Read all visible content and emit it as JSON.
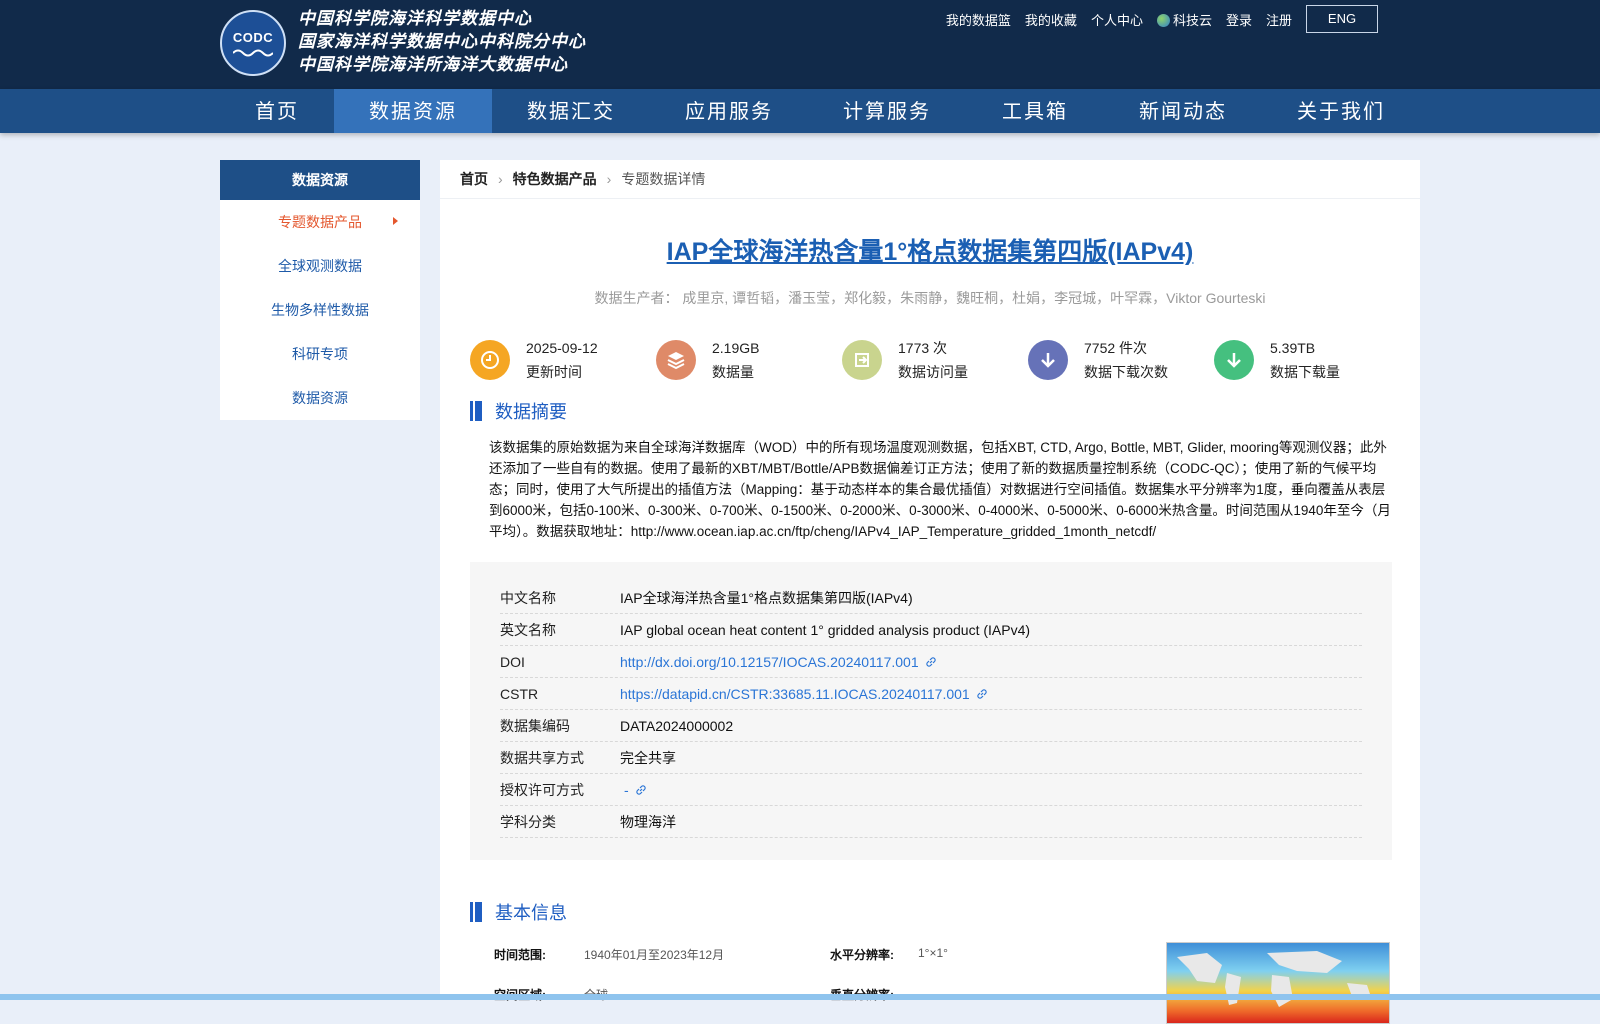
{
  "header": {
    "logo_abbr": "CODC",
    "org_lines": [
      "中国科学院海洋科学数据中心",
      "国家海洋科学数据中心中科院分中心",
      "中国科学院海洋所海洋大数据中心"
    ],
    "user_links": [
      "我的数据篮",
      "我的收藏",
      "个人中心",
      "科技云",
      "登录",
      "注册"
    ],
    "lang": "ENG",
    "colors": {
      "header_bg": "#112a4a",
      "nav_bg": "#1e4f87",
      "nav_active": "#3472ba"
    }
  },
  "nav": {
    "items": [
      "首页",
      "数据资源",
      "数据汇交",
      "应用服务",
      "计算服务",
      "工具箱",
      "新闻动态",
      "关于我们"
    ],
    "active": "数据资源"
  },
  "sidebar": {
    "title": "数据资源",
    "items": [
      "专题数据产品",
      "全球观测数据",
      "生物多样性数据",
      "科研专项",
      "数据资源"
    ],
    "active": "专题数据产品"
  },
  "breadcrumb": [
    "首页",
    "特色数据产品",
    "专题数据详情"
  ],
  "dataset": {
    "title": "IAP全球海洋热含量1°格点数据集第四版(IAPv4)",
    "producers_label": "数据生产者：",
    "producers": "成里京, 谭哲韬，潘玉莹，郑化毅，朱雨静，魏旺桐，杜娟，李冠城，叶罕霖，Viktor Gourteski"
  },
  "stats": [
    {
      "value": "2025-09-12",
      "label": "更新时间",
      "icon": "clock-icon",
      "color": "#f5a623"
    },
    {
      "value": "2.19GB",
      "label": "数据量",
      "icon": "layers-icon",
      "color": "#df8a68"
    },
    {
      "value": "1773 次",
      "label": "数据访问量",
      "icon": "access-icon",
      "color": "#c9d48e"
    },
    {
      "value": "7752 件次",
      "label": "数据下载次数",
      "icon": "download-count-icon",
      "color": "#6672b8"
    },
    {
      "value": "5.39TB",
      "label": "数据下载量",
      "icon": "download-volume-icon",
      "color": "#45c07f"
    }
  ],
  "abstract": {
    "title": "数据摘要",
    "text": "该数据集的原始数据为来自全球海洋数据库（WOD）中的所有现场温度观测数据，包括XBT, CTD, Argo, Bottle, MBT, Glider, mooring等观测仪器；此外还添加了一些自有的数据。使用了最新的XBT/MBT/Bottle/APB数据偏差订正方法；使用了新的数据质量控制系统（CODC-QC）；使用了新的气候平均态；同时，使用了大气所提出的插值方法（Mapping：基于动态样本的集合最优插值）对数据进行空间插值。数据集水平分辨率为1度，垂向覆盖从表层到6000米，包括0-100米、0-300米、0-700米、0-1500米、0-2000米、0-3000米、0-4000米、0-5000米、0-6000米热含量。时间范围从1940年至今（月平均）。数据获取地址：http://www.ocean.iap.ac.cn/ftp/cheng/IAPv4_IAP_Temperature_gridded_1month_netcdf/"
  },
  "info_table": [
    {
      "label": "中文名称",
      "value": "IAP全球海洋热含量1°格点数据集第四版(IAPv4)",
      "link": false
    },
    {
      "label": "英文名称",
      "value": "IAP global ocean heat content 1° gridded analysis product (IAPv4)",
      "link": false
    },
    {
      "label": "DOI",
      "value": "http://dx.doi.org/10.12157/IOCAS.20240117.001",
      "link": true
    },
    {
      "label": "CSTR",
      "value": "https://datapid.cn/CSTR:33685.11.IOCAS.20240117.001",
      "link": true
    },
    {
      "label": "数据集编码",
      "value": "DATA2024000002",
      "link": false
    },
    {
      "label": "数据共享方式",
      "value": "完全共享",
      "link": false
    },
    {
      "label": "授权许可方式",
      "value": "-",
      "link": true
    },
    {
      "label": "学科分类",
      "value": "物理海洋",
      "link": false
    }
  ],
  "basic_info": {
    "title": "基本信息",
    "fields": [
      {
        "label": "时间范围:",
        "value": "1940年01月至2023年12月"
      },
      {
        "label": "水平分辨率:",
        "value": "1°×1°"
      },
      {
        "label": "空间区域:",
        "value": "全球"
      },
      {
        "label": "垂直分辨率:",
        "value": ""
      }
    ]
  }
}
